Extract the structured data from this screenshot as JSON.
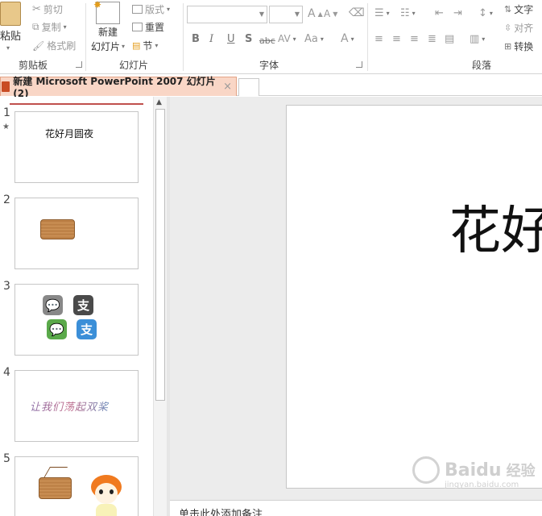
{
  "ribbon": {
    "clipboard": {
      "group_label": "剪贴板",
      "paste": "粘贴",
      "cut": "剪切",
      "copy": "复制",
      "format_painter": "格式刷"
    },
    "slides": {
      "group_label": "幻灯片",
      "new_slide_line1": "新建",
      "new_slide_line2": "幻灯片",
      "layout": "版式",
      "reset": "重置",
      "section": "节"
    },
    "font": {
      "group_label": "字体",
      "grow": "A",
      "shrink": "A",
      "bold": "B",
      "italic": "I",
      "underline": "U",
      "shadow": "S",
      "strike": "abc",
      "spacing": "AV",
      "change_case": "Aa",
      "color": "A"
    },
    "paragraph": {
      "group_label": "段落",
      "text_direction": "文字",
      "align_text": "对齐",
      "convert": "转换"
    }
  },
  "tab": {
    "title": "新建 Microsoft PowerPoint 2007 幻灯片 (2)",
    "close": "×"
  },
  "thumbnails": [
    {
      "num": "1",
      "title": "花好月圆夜"
    },
    {
      "num": "2"
    },
    {
      "num": "3",
      "alipay_glyph": "支"
    },
    {
      "num": "4",
      "handwriting": "让我们荡起双桨"
    },
    {
      "num": "5"
    }
  ],
  "slide": {
    "title": "花好"
  },
  "notes": {
    "placeholder": "单击此处添加备注"
  },
  "watermark": {
    "brand": "Baidu",
    "suffix": "经验",
    "sub": "jingyan.baidu.com"
  },
  "colors": {
    "tab_bg": "#f9d6c6",
    "accent": "#c0504d",
    "wechat": "#5aa94a",
    "alipay": "#3b8fd8"
  }
}
